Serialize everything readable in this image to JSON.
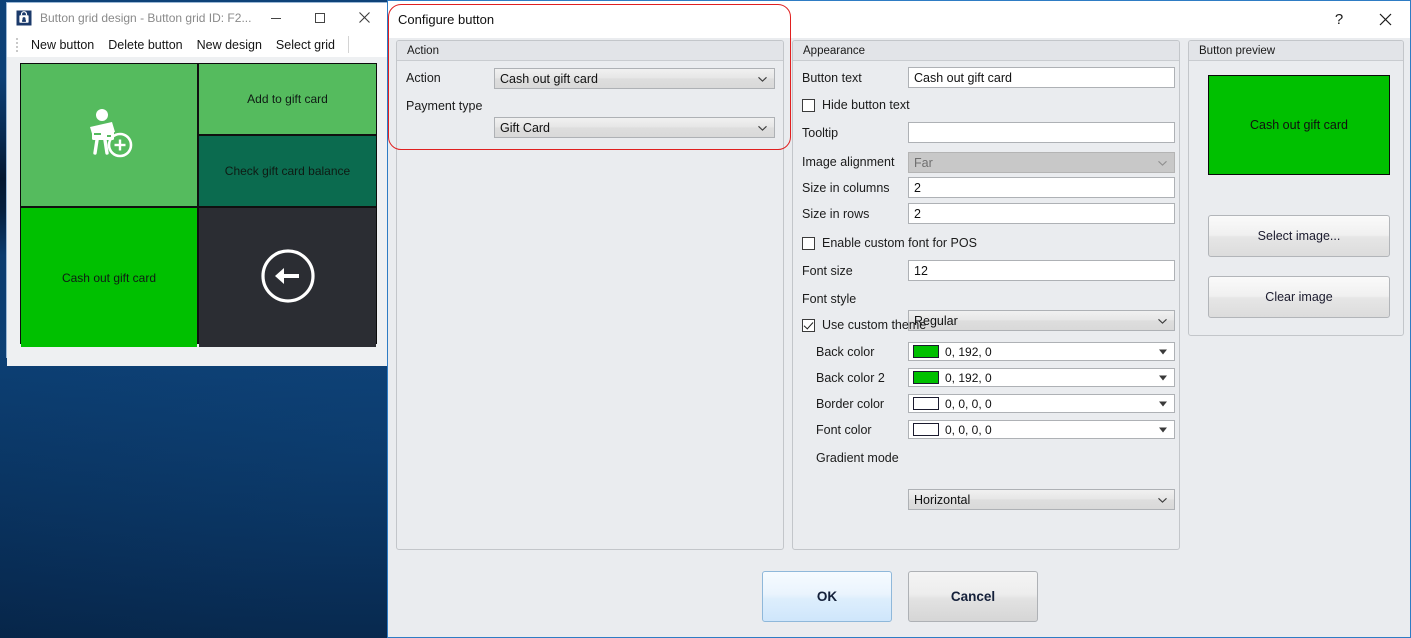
{
  "background_window": {
    "title": "Button grid design - Button grid ID: F2...",
    "icon": "app-icon",
    "caption_buttons": {
      "minimize": "—",
      "maximize": "☐",
      "close": "×"
    },
    "menu_items": [
      "New button",
      "Delete button",
      "New design",
      "Select grid"
    ],
    "grid_tiles": [
      {
        "label": "",
        "icon": "person-with-card-plus-icon",
        "color": "#55bb5e"
      },
      {
        "label": "Add to gift card",
        "icon": "",
        "color": "#55bb5e"
      },
      {
        "label": "Check gift card balance",
        "icon": "",
        "color": "#0b6b4f"
      },
      {
        "label": "Cash out gift card",
        "icon": "",
        "color": "#00c000"
      },
      {
        "label": "",
        "icon": "back-arrow-icon",
        "color": "#2b2d33"
      }
    ]
  },
  "dialog": {
    "title": "Configure button",
    "help_label": "?",
    "close_label": "✕",
    "action_panel": {
      "header": "Action",
      "action_label": "Action",
      "action_value": "Cash out gift card",
      "payment_type_label": "Payment type",
      "payment_type_value": "Gift Card"
    },
    "appearance_panel": {
      "header": "Appearance",
      "button_text_label": "Button text",
      "button_text_value": "Cash out gift card",
      "hide_button_text_label": "Hide button text",
      "hide_button_text_checked": false,
      "tooltip_label": "Tooltip",
      "tooltip_value": "",
      "image_alignment_label": "Image alignment",
      "image_alignment_value": "Far",
      "size_in_columns_label": "Size in columns",
      "size_in_columns_value": "2",
      "size_in_rows_label": "Size in rows",
      "size_in_rows_value": "2",
      "enable_custom_font_label": "Enable custom font for POS",
      "enable_custom_font_checked": false,
      "font_size_label": "Font size",
      "font_size_value": "12",
      "font_style_label": "Font style",
      "font_style_value": "Regular",
      "use_custom_theme_label": "Use custom theme",
      "use_custom_theme_checked": true,
      "back_color_label": "Back color",
      "back_color_value": "0, 192, 0",
      "back_color_swatch": "#00c000",
      "back_color2_label": "Back color 2",
      "back_color2_value": "0, 192, 0",
      "back_color2_swatch": "#00c000",
      "border_color_label": "Border color",
      "border_color_value": "0, 0, 0, 0",
      "border_color_swatch": "#ffffff",
      "font_color_label": "Font color",
      "font_color_value": "0, 0, 0, 0",
      "font_color_swatch": "#ffffff",
      "gradient_mode_label": "Gradient mode",
      "gradient_mode_value": "Horizontal"
    },
    "preview_panel": {
      "header": "Button preview",
      "preview_button_text": "Cash out gift card",
      "preview_button_color": "#00c000",
      "select_image_label": "Select image...",
      "clear_image_label": "Clear image"
    },
    "footer": {
      "ok_label": "OK",
      "cancel_label": "Cancel"
    }
  },
  "annotation": {
    "color": "#e02020",
    "target": "action-group"
  }
}
